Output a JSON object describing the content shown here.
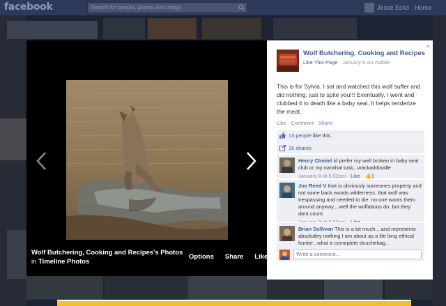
{
  "topbar": {
    "logo": "facebook",
    "search_placeholder": "Search for people, places and things",
    "user_name": "Jesse Ecko",
    "home_label": "Home"
  },
  "photo_viewer": {
    "caption_title": "Wolf Butchering, Cooking and Recipes's Photos",
    "caption_in": "in",
    "caption_album": "Timeline Photos",
    "actions": [
      "Options",
      "Share",
      "Like"
    ]
  },
  "sidebar": {
    "close": "×",
    "page_name": "Wolf Butchering, Cooking and Recipes",
    "like_page": "Like This Page",
    "meta": "· January 8 via mobile",
    "post_text": "This is for Sylvia. I sat and watched this wolf suffer and did nothing, just to spite you!!! Eventually, I went and clubbed it to death like a baby seal. It helps tenderize the meat.",
    "post_actions": {
      "like": "Like",
      "comment": "Comment",
      "share": "Share"
    },
    "likes": {
      "count": "13 people",
      "suffix": "like this."
    },
    "shares": "16 shares",
    "comments": [
      {
        "name": "Henry Chmiel",
        "text": "id prefer my well broken in baby seal club or my narwhal tusk,, wackaddoodle",
        "time": "January 8 at 5:52pm",
        "like": "Like",
        "likes": "1"
      },
      {
        "name": "Joe Reed V",
        "text": "that is obviously someones property and not some back woods wilderness. that wolf was trespassing and needed to die. no one wants them around anyway....well the wolfaboos do. but they dont count",
        "time": "January 8 at 5:55pm",
        "like": "Like"
      },
      {
        "name": "Brian Sullivan",
        "text": "This is a bit much....and represents absolutley nothing I am about as a life long ethical hunter...what a comeplete douchebag...",
        "time": "",
        "like": ""
      }
    ],
    "write_placeholder": "Write a comment..."
  }
}
